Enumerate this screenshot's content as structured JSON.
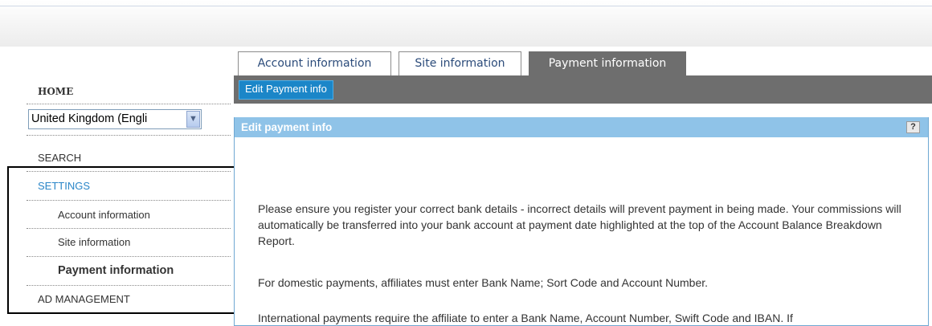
{
  "sidebar": {
    "home": "HOME",
    "country_select": {
      "value": "United Kingdom (Engli",
      "arrow": "chevron-down-icon"
    },
    "items": [
      {
        "label": "SEARCH"
      },
      {
        "label": "SETTINGS"
      },
      {
        "label": "Account information"
      },
      {
        "label": "Site information"
      },
      {
        "label": "Payment information"
      },
      {
        "label": "AD MANAGEMENT"
      }
    ]
  },
  "tabs": [
    {
      "label": "Account information"
    },
    {
      "label": "Site information"
    },
    {
      "label": "Payment information"
    }
  ],
  "toolbar": {
    "edit_button": "Edit Payment info"
  },
  "panel": {
    "title": "Edit payment info",
    "help": "?",
    "paragraphs": [
      "Please ensure you register your correct bank details - incorrect details will prevent payment in being made. Your commissions will automatically be transferred into your bank account at payment date highlighted at the top of the Account Balance Breakdown Report.",
      "For domestic payments, affiliates must enter Bank Name; Sort Code and Account Number.",
      "International payments require the affiliate to enter a Bank Name, Account Number, Swift Code and IBAN. If"
    ]
  },
  "colors": {
    "settings_link": "#2a86c8",
    "toolbar_bg": "#6e6e6e",
    "button_bg": "#1b86c8",
    "panel_header_bg": "#8fc3e8"
  }
}
